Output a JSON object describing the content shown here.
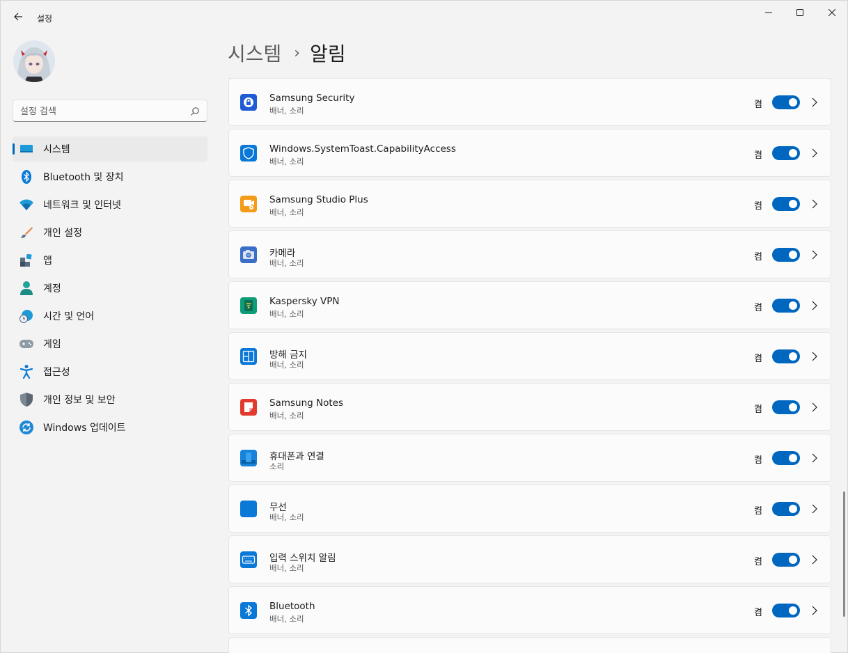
{
  "window": {
    "title": "설정",
    "controls": {
      "minimize": "minimize-icon",
      "maximize": "maximize-icon",
      "close": "close-icon"
    }
  },
  "sidebar": {
    "search_placeholder": "설정 검색",
    "items": [
      {
        "label": "시스템",
        "icon": "system-icon",
        "selected": true
      },
      {
        "label": "Bluetooth 및 장치",
        "icon": "bluetooth-icon"
      },
      {
        "label": "네트워크 및 인터넷",
        "icon": "wifi-icon"
      },
      {
        "label": "개인 설정",
        "icon": "brush-icon"
      },
      {
        "label": "앱",
        "icon": "apps-icon"
      },
      {
        "label": "계정",
        "icon": "account-icon"
      },
      {
        "label": "시간 및 언어",
        "icon": "globe-clock-icon"
      },
      {
        "label": "게임",
        "icon": "gamepad-icon"
      },
      {
        "label": "접근성",
        "icon": "accessibility-icon"
      },
      {
        "label": "개인 정보 및 보안",
        "icon": "shield-icon"
      },
      {
        "label": "Windows 업데이트",
        "icon": "update-icon"
      }
    ]
  },
  "breadcrumb": {
    "parent": "시스템",
    "separator": "›",
    "current": "알림"
  },
  "apps": [
    {
      "name": "Samsung Security",
      "sub": "배너, 소리",
      "state": "켬",
      "on": true,
      "icon": "samsung-security-icon",
      "color": "#1f5bd6"
    },
    {
      "name": "Windows.SystemToast.CapabilityAccess",
      "sub": "배너, 소리",
      "state": "켬",
      "on": true,
      "icon": "shield-app-icon",
      "color": "#0a78d7"
    },
    {
      "name": "Samsung Studio Plus",
      "sub": "배너, 소리",
      "state": "켬",
      "on": true,
      "icon": "samsung-studio-plus-icon",
      "color": "#f59b1a"
    },
    {
      "name": "카메라",
      "sub": "배너, 소리",
      "state": "켬",
      "on": true,
      "icon": "camera-icon",
      "color": "#3b6fc7"
    },
    {
      "name": "Kaspersky VPN",
      "sub": "배너, 소리",
      "state": "켬",
      "on": true,
      "icon": "kaspersky-vpn-icon",
      "color": "#0f9d77"
    },
    {
      "name": "방해 금지",
      "sub": "배너, 소리",
      "state": "켬",
      "on": true,
      "icon": "do-not-disturb-icon",
      "color": "#0a78d7"
    },
    {
      "name": "Samsung Notes",
      "sub": "배너, 소리",
      "state": "켬",
      "on": true,
      "icon": "samsung-notes-icon",
      "color": "#e23a2e"
    },
    {
      "name": "휴대폰과 연결",
      "sub": "소리",
      "state": "켬",
      "on": true,
      "icon": "phone-link-icon",
      "color": "#1583d9"
    },
    {
      "name": "무선",
      "sub": "배너, 소리",
      "state": "켬",
      "on": true,
      "icon": "wireless-icon",
      "color": "#0a78d7"
    },
    {
      "name": "입력 스위치 알림",
      "sub": "배너, 소리",
      "state": "켬",
      "on": true,
      "icon": "keyboard-icon",
      "color": "#0a78d7"
    },
    {
      "name": "Bluetooth",
      "sub": "배너, 소리",
      "state": "켬",
      "on": true,
      "icon": "bluetooth-app-icon",
      "color": "#0a78d7"
    }
  ],
  "colors": {
    "accent": "#0067c0",
    "background": "#f3f3f3",
    "card": "#fbfbfb"
  }
}
